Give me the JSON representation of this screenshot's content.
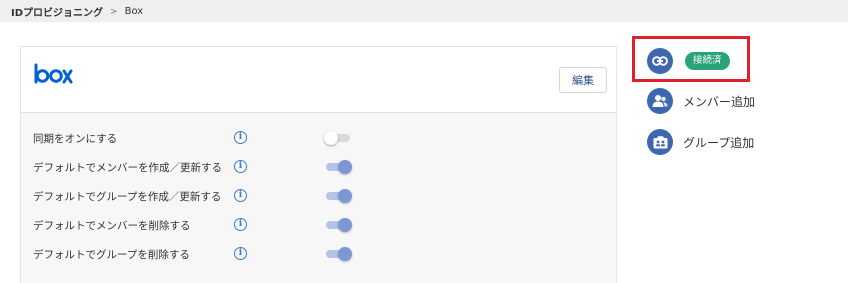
{
  "breadcrumb": {
    "parent": "IDプロビジョニング",
    "separator": ">",
    "current": "Box"
  },
  "card": {
    "logo_text": "box",
    "edit_label": "編集",
    "settings": [
      {
        "label": "同期をオンにする",
        "info": "i",
        "enabled": false
      },
      {
        "label": "デフォルトでメンバーを作成／更新する",
        "info": "i",
        "enabled": true
      },
      {
        "label": "デフォルトでグループを作成／更新する",
        "info": "i",
        "enabled": true
      },
      {
        "label": "デフォルトでメンバーを削除する",
        "info": "i",
        "enabled": true
      },
      {
        "label": "デフォルトでグループを削除する",
        "info": "i",
        "enabled": true
      }
    ]
  },
  "side": {
    "connection": {
      "icon": "link-icon",
      "status": "接続済"
    },
    "add_member": {
      "icon": "users-icon",
      "label": "メンバー追加"
    },
    "add_group": {
      "icon": "group-icon",
      "label": "グループ追加"
    }
  },
  "colors": {
    "accent": "#3f67b0",
    "success": "#2aa37a",
    "highlight": "#e0202a",
    "box_brand": "#0061d5"
  }
}
